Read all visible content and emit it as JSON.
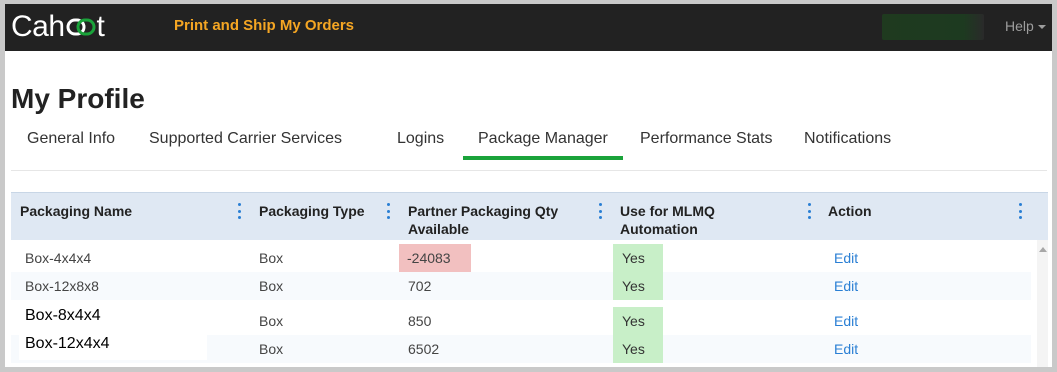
{
  "app": {
    "logo_left": "Cah",
    "logo_right": "t",
    "nav_title": "Print and Ship My Orders",
    "help_label": "Help"
  },
  "page": {
    "title": "My Profile"
  },
  "tabs": [
    {
      "label": "General Info",
      "active": false
    },
    {
      "label": "Supported Carrier Services",
      "active": false
    },
    {
      "label": "Logins",
      "active": false
    },
    {
      "label": "Package Manager",
      "active": true
    },
    {
      "label": "Performance Stats",
      "active": false
    },
    {
      "label": "Notifications",
      "active": false
    }
  ],
  "grid": {
    "columns": [
      {
        "label": "Packaging Name"
      },
      {
        "label": "Packaging Type"
      },
      {
        "label": "Partner Packaging Qty Available"
      },
      {
        "label": "Use for MLMQ Automation"
      },
      {
        "label": "Action"
      }
    ],
    "rows": [
      {
        "name": "Box-4x4x4",
        "type": "Box",
        "qty": "-24083",
        "mlmq": "Yes",
        "action": "Edit"
      },
      {
        "name": "Box-12x8x8",
        "type": "Box",
        "qty": "702",
        "mlmq": "Yes",
        "action": "Edit"
      },
      {
        "name": "Box-8x4x4",
        "type": "Box",
        "qty": "850",
        "mlmq": "Yes",
        "action": "Edit"
      },
      {
        "name": "Box-12x4x4",
        "type": "Box",
        "qty": "6502",
        "mlmq": "Yes",
        "action": "Edit"
      }
    ]
  },
  "colors": {
    "topbar": "#222222",
    "brand_orange": "#f5a623",
    "tab_active": "#1aa33a",
    "link": "#2a7fd4",
    "negative_qty": "#f2c0c0",
    "yes_bg": "#c8efc8",
    "header_bg": "#dfe8f3"
  },
  "icons": {
    "column_menu": "kebab-vertical-icon",
    "help_caret": "caret-down-icon",
    "logo_mark": "link-chain-icon"
  }
}
